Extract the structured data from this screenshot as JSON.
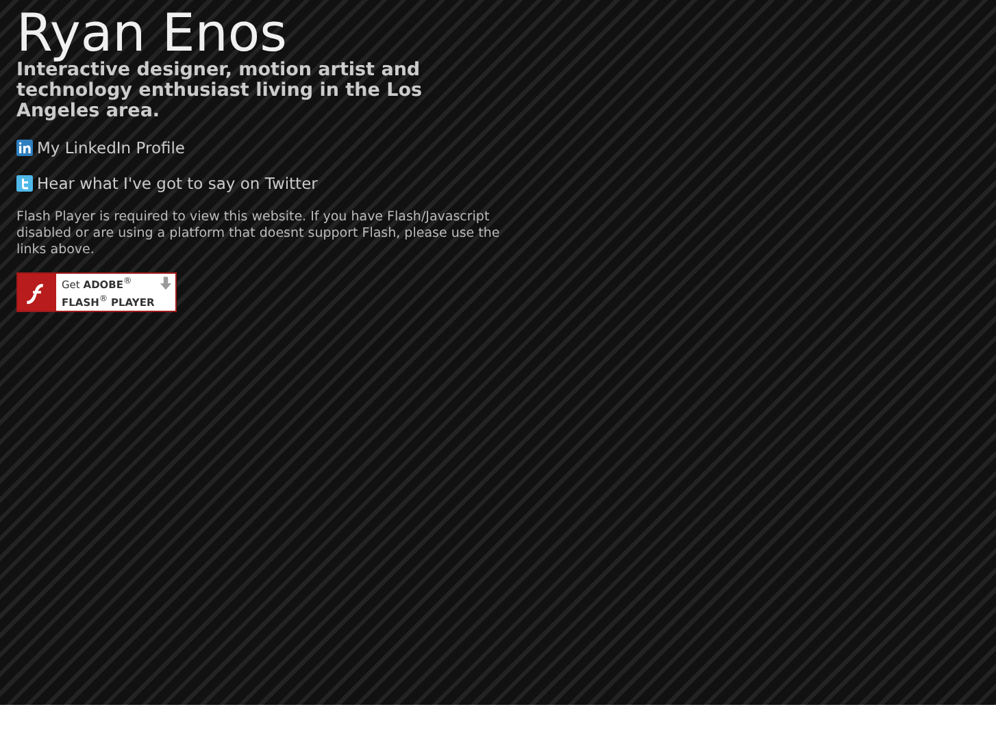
{
  "title": "Ryan Enos",
  "tagline": "Interactive designer, motion artist and technology enthusiast living in the Los Angeles area.",
  "links": [
    {
      "kind": "linkedin",
      "label": "My LinkedIn Profile"
    },
    {
      "kind": "twitter",
      "label": "Hear what I've got to say on Twitter"
    }
  ],
  "notice": "Flash Player is required to view this website. If you have Flash/Javascript disabled or are using a platform that doesnt support Flash, please use the links above.",
  "badge": {
    "line_1": "Get **ADOBE**$^{®}$",
    "line_2": "**FLASH**$^{®}$ **PLAYER**"
  }
}
